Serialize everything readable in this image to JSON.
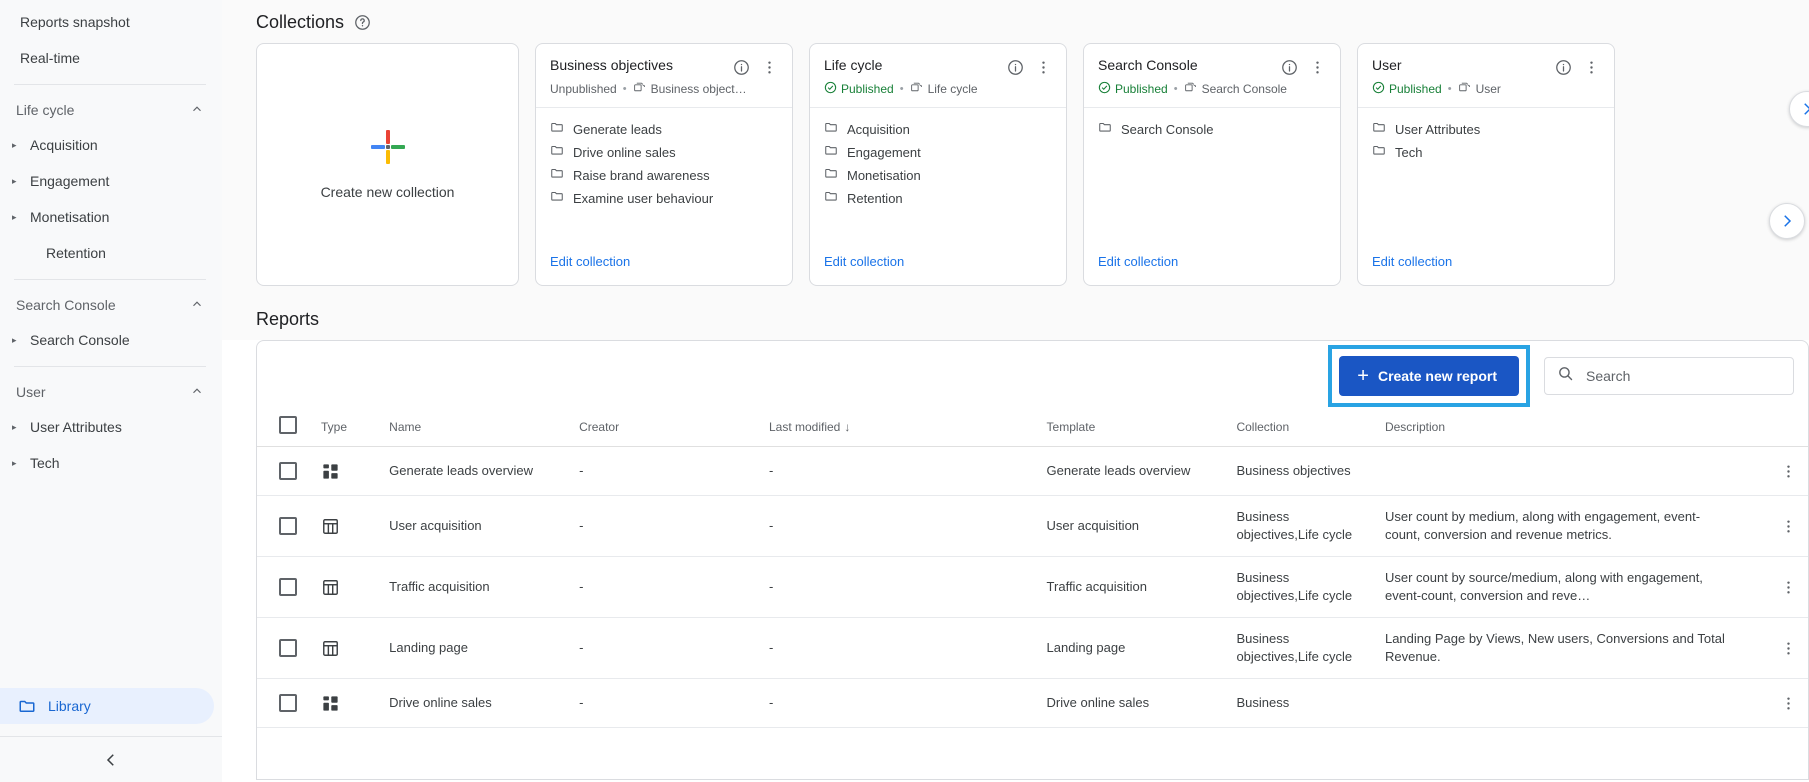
{
  "sidebar": {
    "top_items": [
      {
        "label": "Reports snapshot",
        "expandable": false
      },
      {
        "label": "Real-time",
        "expandable": false
      }
    ],
    "groups": [
      {
        "title": "Life cycle",
        "chevron": "collapse-chevron",
        "items": [
          {
            "label": "Acquisition",
            "expandable": true
          },
          {
            "label": "Engagement",
            "expandable": true
          },
          {
            "label": "Monetisation",
            "expandable": true
          },
          {
            "label": "Retention",
            "expandable": false
          }
        ]
      },
      {
        "title": "Search Console",
        "chevron": "collapse-chevron",
        "items": [
          {
            "label": "Search Console",
            "expandable": true
          }
        ]
      },
      {
        "title": "User",
        "chevron": "collapse-chevron",
        "items": [
          {
            "label": "User Attributes",
            "expandable": true
          },
          {
            "label": "Tech",
            "expandable": true
          }
        ]
      }
    ],
    "library": {
      "label": "Library",
      "icon": "folder-icon",
      "active_color": "#1967d2",
      "active_bg": "#e8f0fe"
    },
    "collapse_icon": "chevron-left-icon"
  },
  "collections": {
    "title": "Collections",
    "help_icon": "help-circle-icon",
    "create_card": {
      "label": "Create new collection",
      "icon": "plus-icon"
    },
    "edit_link_label": "Edit collection",
    "cards": [
      {
        "title": "Business objectives",
        "status": "Unpublished",
        "published": false,
        "source": "Business object…",
        "topics": [
          "Generate leads",
          "Drive online sales",
          "Raise brand awareness",
          "Examine user behaviour"
        ]
      },
      {
        "title": "Life cycle",
        "status": "Published",
        "published": true,
        "source": "Life cycle",
        "topics": [
          "Acquisition",
          "Engagement",
          "Monetisation",
          "Retention"
        ]
      },
      {
        "title": "Search Console",
        "status": "Published",
        "published": true,
        "source": "Search Console",
        "topics": [
          "Search Console"
        ]
      },
      {
        "title": "User",
        "status": "Published",
        "published": true,
        "source": "User",
        "topics": [
          "User Attributes",
          "Tech"
        ]
      }
    ],
    "scroll_right_icon": "chevron-right-icon"
  },
  "reports": {
    "title": "Reports",
    "create_button": {
      "label": "Create new report",
      "icon": "plus-icon",
      "bg": "#1a56c4"
    },
    "highlight_color": "#29a3e3",
    "search": {
      "placeholder": "Search",
      "value": "",
      "icon": "search-icon"
    },
    "columns": [
      "Type",
      "Name",
      "Creator",
      "Last modified",
      "Template",
      "Collection",
      "Description"
    ],
    "sort_column": "Last modified",
    "sort_icon": "arrow-down-icon",
    "rows": [
      {
        "type_icon": "dashboard-overview-icon",
        "name": "Generate leads overview",
        "creator": "-",
        "last_modified": "-",
        "template": "Generate leads overview",
        "collection": "Business objectives",
        "description": ""
      },
      {
        "type_icon": "table-report-icon",
        "name": "User acquisition",
        "creator": "-",
        "last_modified": "-",
        "template": "User acquisition",
        "collection": "Business objectives,Life cycle",
        "description": "User count by medium, along with engagement, event-count, conversion and revenue metrics."
      },
      {
        "type_icon": "table-report-icon",
        "name": "Traffic acquisition",
        "creator": "-",
        "last_modified": "-",
        "template": "Traffic acquisition",
        "collection": "Business objectives,Life cycle",
        "description": "User count by source/medium, along with engagement, event-count, conversion and reve…"
      },
      {
        "type_icon": "table-report-icon",
        "name": "Landing page",
        "creator": "-",
        "last_modified": "-",
        "template": "Landing page",
        "collection": "Business objectives,Life cycle",
        "description": "Landing Page by Views, New users, Conversions and Total Revenue."
      },
      {
        "type_icon": "dashboard-overview-icon",
        "name": "Drive online sales",
        "creator": "-",
        "last_modified": "-",
        "template": "Drive online sales",
        "collection": "Business",
        "description": ""
      }
    ]
  }
}
